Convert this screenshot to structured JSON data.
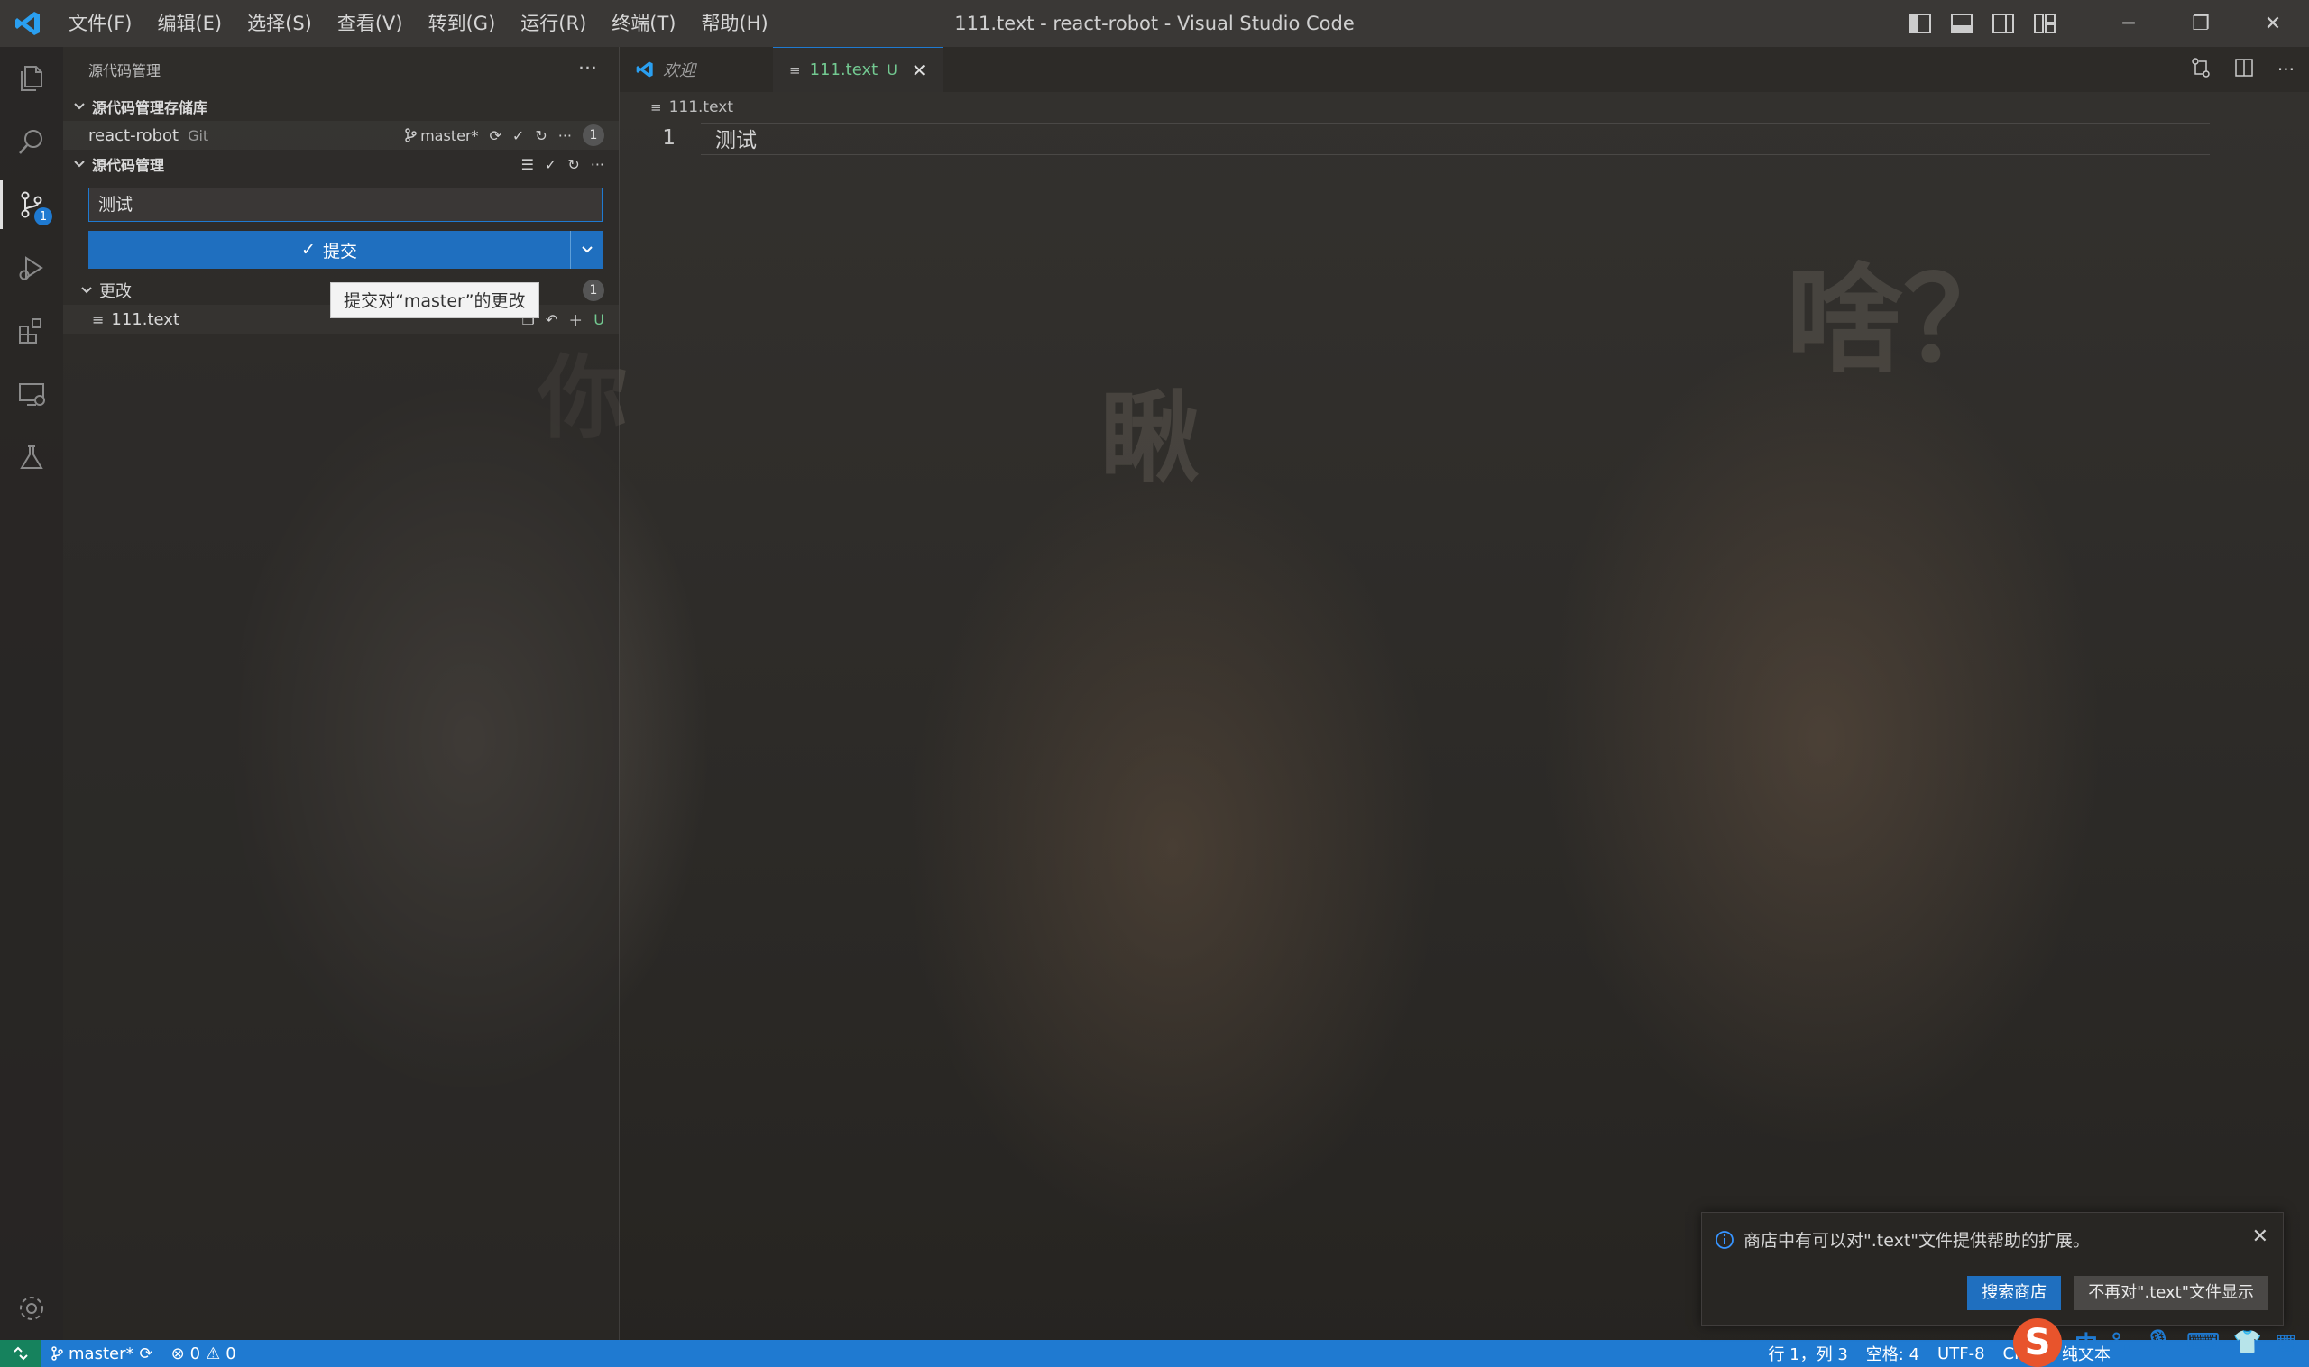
{
  "window": {
    "title": "111.text - react-robot - Visual Studio Code",
    "menu": [
      "文件(F)",
      "编辑(E)",
      "选择(S)",
      "查看(V)",
      "转到(G)",
      "运行(R)",
      "终端(T)",
      "帮助(H)"
    ]
  },
  "activity_bar": {
    "items": [
      "files-icon",
      "search-icon",
      "source-control-icon",
      "run-debug-icon",
      "extensions-icon",
      "remote-explorer-icon",
      "testing-icon"
    ],
    "source_control_badge": "1",
    "bottom": "gear-icon"
  },
  "sidebar": {
    "header": "源代码管理",
    "repos_section": "源代码管理存储库",
    "repo": {
      "name": "react-robot",
      "type": "Git",
      "branch": "master*",
      "count": "1"
    },
    "scm_section": "源代码管理",
    "commit_message": "测试",
    "commit_button": "提交",
    "tooltip": "提交对“master”的更改",
    "changes": {
      "label": "更改",
      "count": "1",
      "files": [
        {
          "name": "111.text",
          "status": "U"
        }
      ]
    }
  },
  "editor": {
    "tabs": [
      {
        "label": "欢迎",
        "active": false
      },
      {
        "label": "111.text",
        "status": "U",
        "active": true
      }
    ],
    "breadcrumb": "111.text",
    "lines": [
      {
        "number": "1",
        "text": "测试"
      }
    ]
  },
  "wallpaper_text": [
    "你",
    "瞅",
    "啥？"
  ],
  "notification": {
    "message": "商店中有可以对\".text\"文件提供帮助的扩展。",
    "primary_button": "搜索商店",
    "secondary_button": "不再对\".text\"文件显示"
  },
  "statusbar": {
    "branch": "master*",
    "errors": "0",
    "warnings": "0",
    "position": "行 1，列 3",
    "spaces": "空格: 4",
    "encoding": "UTF-8",
    "eol": "CRLF",
    "language": "纯文本"
  },
  "ime": {
    "mode": "中",
    "punct": "°,"
  },
  "colors": {
    "accent": "#1f7ad1",
    "untracked": "#73c991",
    "remote_button": "#16825d"
  }
}
